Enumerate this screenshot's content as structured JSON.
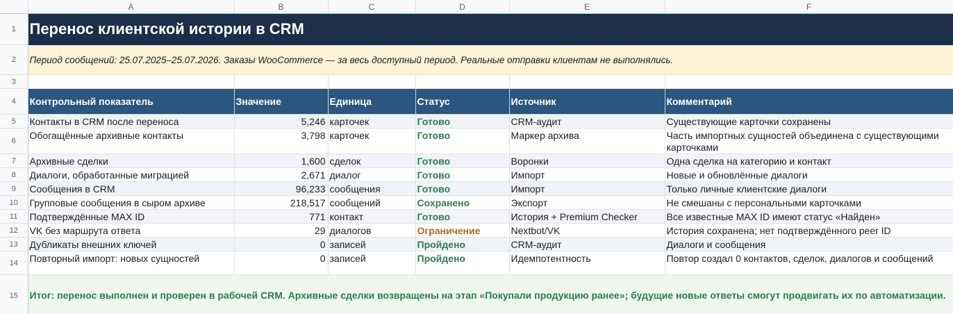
{
  "columns": [
    "A",
    "B",
    "C",
    "D",
    "E",
    "F"
  ],
  "row_numbers": [
    "1",
    "2",
    "3",
    "4",
    "5",
    "6",
    "7",
    "8",
    "9",
    "10",
    "11",
    "12",
    "13",
    "14",
    "15"
  ],
  "title": "Перенос клиентской истории в CRM",
  "period_note": "Период сообщений: 25.07.2025–25.07.2026. Заказы WooCommerce — за весь доступный период. Реальные отправки клиентам не выполнялись.",
  "headers": [
    "Контрольный показатель",
    "Значение",
    "Единица",
    "Статус",
    "Источник",
    "Комментарий"
  ],
  "rows": [
    {
      "metric": "Контакты в CRM после переноса",
      "value": "5,246",
      "unit": "карточек",
      "status": "Готово",
      "source": "CRM-аудит",
      "comment": "Существующие карточки сохранены"
    },
    {
      "metric": "Обогащённые архивные контакты",
      "value": "3,798",
      "unit": "карточек",
      "status": "Готово",
      "source": "Маркер архива",
      "comment": "Часть импортных сущностей объединена с существующими карточками"
    },
    {
      "metric": "Архивные сделки",
      "value": "1,600",
      "unit": "сделок",
      "status": "Готово",
      "source": "Воронки",
      "comment": "Одна сделка на категорию и контакт"
    },
    {
      "metric": "Диалоги, обработанные миграцией",
      "value": "2,671",
      "unit": "диалог",
      "status": "Готово",
      "source": "Импорт",
      "comment": "Новые и обновлённые диалоги"
    },
    {
      "metric": "Сообщения в CRM",
      "value": "96,233",
      "unit": "сообщения",
      "status": "Готово",
      "source": "Импорт",
      "comment": "Только личные клиентские диалоги"
    },
    {
      "metric": "Групповые сообщения в сыром архиве",
      "value": "218,517",
      "unit": "сообщений",
      "status": "Сохранено",
      "source": "Экспорт",
      "comment": "Не смешаны с персональными карточками"
    },
    {
      "metric": "Подтверждённые MAX ID",
      "value": "771",
      "unit": "контакт",
      "status": "Готово",
      "source": "История + Premium Checker",
      "comment": "Все известные MAX ID имеют статус «Найден»"
    },
    {
      "metric": "VK без маршрута ответа",
      "value": "29",
      "unit": "диалогов",
      "status": "Ограничение",
      "source": "Nextbot/VK",
      "comment": "История сохранена; нет подтверждённого peer ID"
    },
    {
      "metric": "Дубликаты внешних ключей",
      "value": "0",
      "unit": "записей",
      "status": "Пройдено",
      "source": "CRM-аудит",
      "comment": "Диалоги и сообщения"
    },
    {
      "metric": "Повторный импорт: новых сущностей",
      "value": "0",
      "unit": "записей",
      "status": "Пройдено",
      "source": "Идемпотентность",
      "comment": "Повтор создал 0 контактов, сделок, диалогов и сообщений"
    }
  ],
  "summary": "Итог: перенос выполнен и проверен в рабочей CRM. Архивные сделки возвращены на этап «Покупали продукцию ранее»; будущие новые ответы смогут продвигать их по автоматизации.",
  "colors": {
    "title_bg": "#1c2e48",
    "header_bg": "#2b5680",
    "period_bg": "#fcf2d5",
    "status_ok": "#2e7d4f",
    "status_limit": "#b26a12",
    "summary_bg": "#eef6ee"
  }
}
